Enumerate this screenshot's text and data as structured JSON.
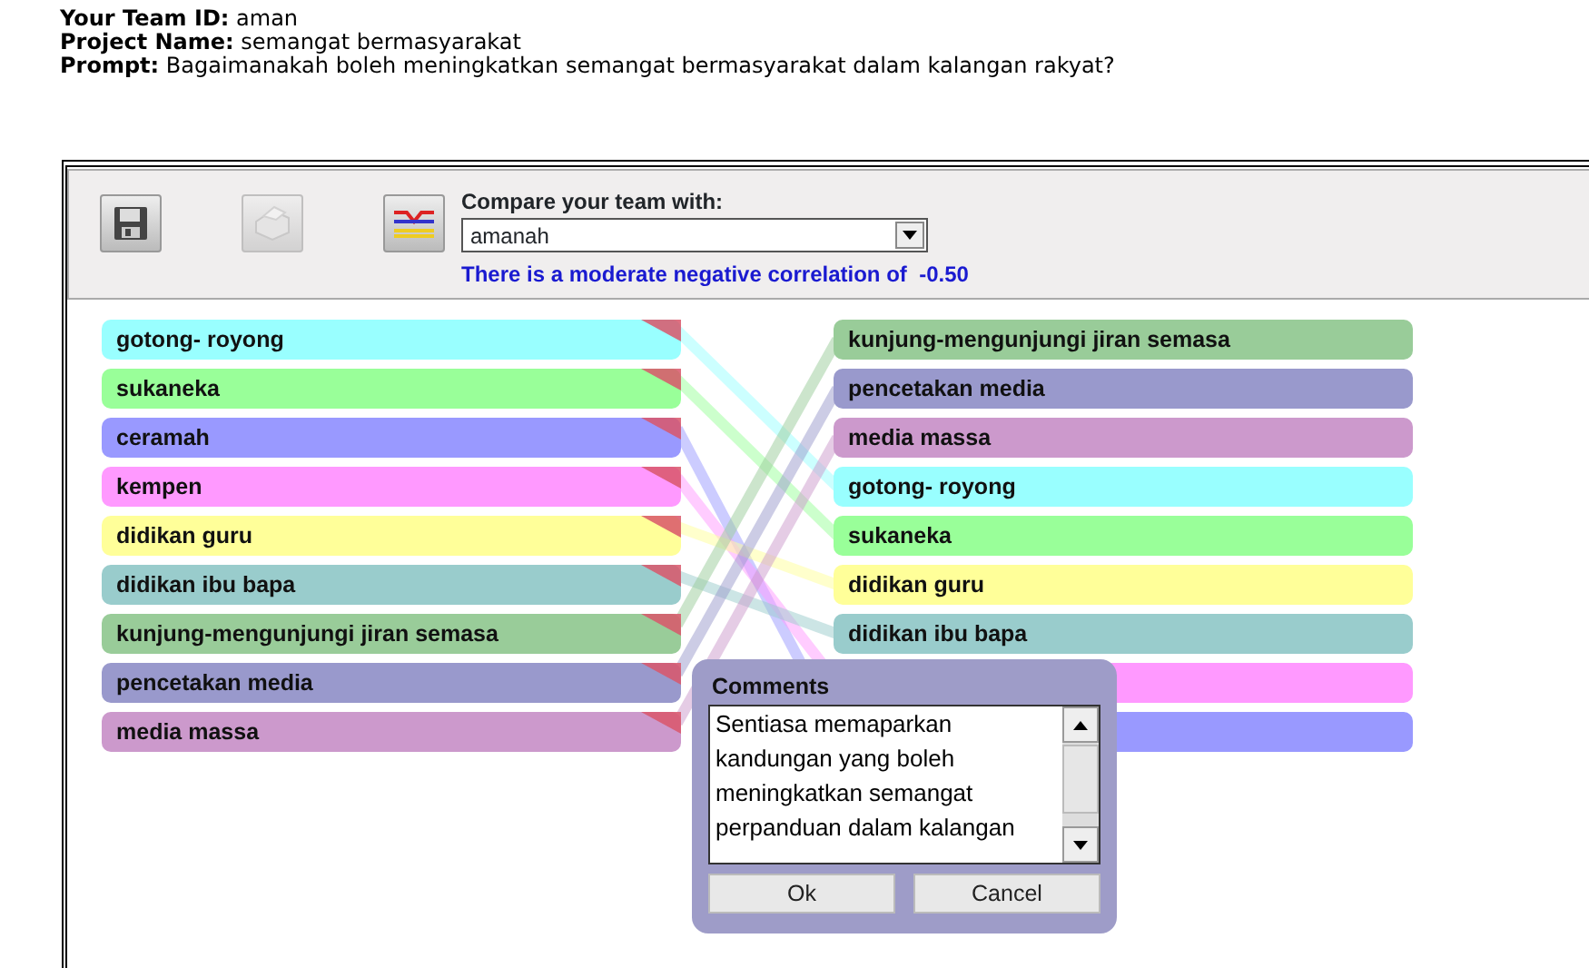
{
  "header": [
    {
      "label": "Your Team ID:",
      "value": "aman"
    },
    {
      "label": "Project Name:",
      "value": "semangat bermasyarakat"
    },
    {
      "label": "Prompt:",
      "value": "Bagaimanakah boleh meningkatkan semangat bermasyarakat dalam kalangan rakyat?"
    }
  ],
  "toolbar": {
    "buttons": [
      {
        "kind": "save",
        "disabled": false
      },
      {
        "kind": "print",
        "disabled": true
      },
      {
        "kind": "compare",
        "disabled": false
      }
    ]
  },
  "compare": {
    "label": "Compare your team with:",
    "value": "amanah",
    "correlation": "There is a moderate negative correlation of  -0.50"
  },
  "left_list": [
    {
      "label": "gotong- royong",
      "color": "#99ffff"
    },
    {
      "label": "sukaneka",
      "color": "#99ff99"
    },
    {
      "label": "ceramah",
      "color": "#9999ff"
    },
    {
      "label": "kempen",
      "color": "#ff99ff"
    },
    {
      "label": "didikan guru",
      "color": "#ffff99"
    },
    {
      "label": "didikan ibu bapa",
      "color": "#99cccc"
    },
    {
      "label": "kunjung-mengunjungi jiran semasa",
      "color": "#99cc99"
    },
    {
      "label": "pencetakan media",
      "color": "#9999cc"
    },
    {
      "label": "media massa",
      "color": "#cc99cc"
    }
  ],
  "right_list": [
    {
      "label": "kunjung-mengunjungi jiran semasa",
      "color": "#99cc99"
    },
    {
      "label": "pencetakan media",
      "color": "#9999cc"
    },
    {
      "label": "media massa",
      "color": "#cc99cc"
    },
    {
      "label": "gotong- royong",
      "color": "#99ffff"
    },
    {
      "label": "sukaneka",
      "color": "#99ff99"
    },
    {
      "label": "didikan guru",
      "color": "#ffff99"
    },
    {
      "label": "didikan ibu bapa",
      "color": "#99cccc"
    },
    {
      "color": "#ff99ff"
    },
    {
      "color": "#9999ff"
    }
  ],
  "comments": {
    "title": "Comments",
    "text": "Sentiasa memaparkan kandungan yang boleh meningkatkan semangat perpanduan dalam kalangan",
    "buttons": [
      "Ok",
      "Cancel"
    ]
  }
}
